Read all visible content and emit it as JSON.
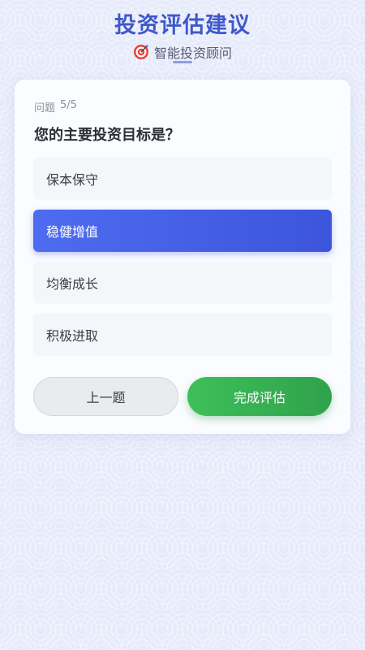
{
  "header": {
    "title": "投资评估建议",
    "subtitle": "智能投资顾问",
    "icon": "target-icon"
  },
  "quiz": {
    "progress_label": "问题",
    "progress_value": "5/5",
    "question": "您的主要投资目标是？",
    "options": [
      {
        "label": "保本保守",
        "selected": false
      },
      {
        "label": "稳健增值",
        "selected": true
      },
      {
        "label": "均衡成长",
        "selected": false
      },
      {
        "label": "积极进取",
        "selected": false
      }
    ],
    "prev_button": "上一题",
    "finish_button": "完成评估"
  },
  "colors": {
    "accent": "#3c55db",
    "title": "#3f58c9",
    "finish": "#2fa24b",
    "background": "#e6ebfb"
  }
}
